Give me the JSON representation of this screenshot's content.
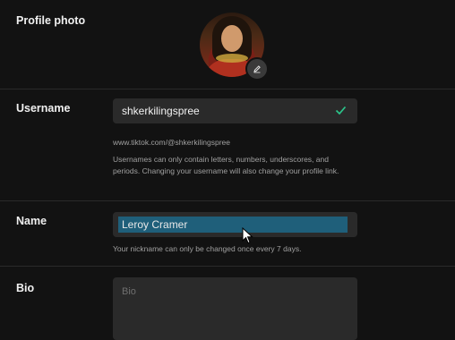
{
  "profile_photo": {
    "label": "Profile photo"
  },
  "username": {
    "label": "Username",
    "value": "shkerkilingspree",
    "url": "www.tiktok.com/@shkerkilingspree",
    "help": "Usernames can only contain letters, numbers, underscores, and periods. Changing your username will also change your profile link."
  },
  "name": {
    "label": "Name",
    "value": "Leroy Cramer",
    "help": "Your nickname can only be changed once every 7 days."
  },
  "bio": {
    "label": "Bio",
    "placeholder": "Bio"
  }
}
